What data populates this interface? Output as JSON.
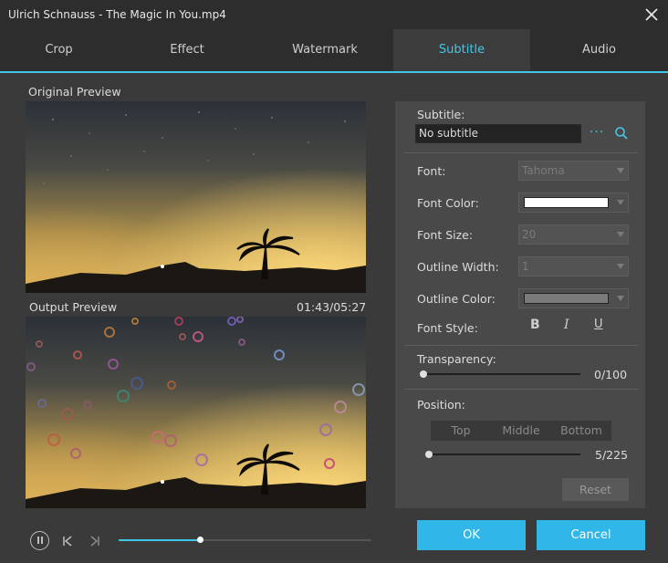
{
  "window": {
    "title": "Ulrich Schnauss - The Magic In You.mp4"
  },
  "tabs": [
    {
      "label": "Crop"
    },
    {
      "label": "Effect"
    },
    {
      "label": "Watermark"
    },
    {
      "label": "Subtitle",
      "active": true
    },
    {
      "label": "Audio"
    }
  ],
  "previews": {
    "original_label": "Original Preview",
    "output_label": "Output Preview",
    "timecode": "01:43/05:27"
  },
  "subtitle": {
    "label": "Subtitle:",
    "value": "No subtitle",
    "more_icon": "ellipsis-icon",
    "search_icon": "search-icon",
    "font_label": "Font:",
    "font_value": "Tahoma",
    "font_color_label": "Font Color:",
    "font_color_value": "#ffffff",
    "font_size_label": "Font Size:",
    "font_size_value": "20",
    "outline_width_label": "Outline Width:",
    "outline_width_value": "1",
    "outline_color_label": "Outline Color:",
    "outline_color_value": "#7a7a7a",
    "font_style_label": "Font Style:",
    "bold": "B",
    "italic": "I",
    "underline": "U",
    "transparency_label": "Transparency:",
    "transparency_value": "0/100",
    "transparency_fraction": 0,
    "position_label": "Position:",
    "position_options": [
      "Top",
      "Middle",
      "Bottom"
    ],
    "position_value": "5/225",
    "position_fraction": 0.022,
    "reset_label": "Reset"
  },
  "buttons": {
    "ok": "OK",
    "cancel": "Cancel"
  },
  "playback": {
    "progress": 0.32
  },
  "colors": {
    "accent": "#40c7e8",
    "button": "#31b6e8",
    "background": "#3b3a3a",
    "panel": "#4a4949"
  }
}
